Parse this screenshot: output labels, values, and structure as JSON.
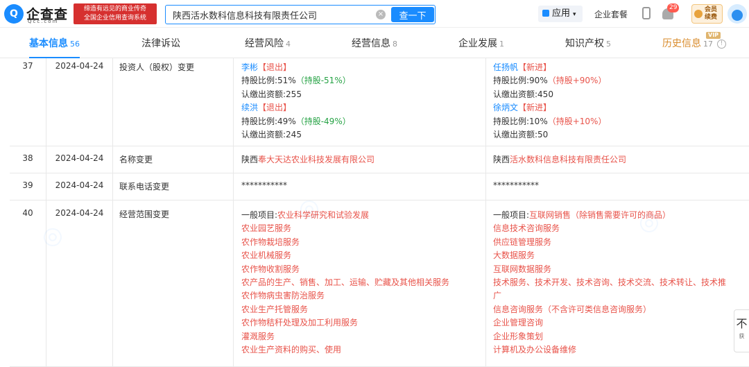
{
  "header": {
    "logo_text": "企查查",
    "logo_mark": "Q",
    "logo_url": "Qcc.com",
    "slogan_line1": "缔造有远见的商业传奇",
    "slogan_line2": "全国企业信用查询系统",
    "search_value": "陕西活水数科信息科技有限责任公司",
    "search_button": "查一下",
    "apps_label": "应用",
    "suite_label": "企业套餐",
    "notifications_count": "29",
    "member_line1": "会员",
    "member_line2": "续费"
  },
  "tabs": [
    {
      "label": "基本信息",
      "count": "56",
      "active": true
    },
    {
      "label": "法律诉讼",
      "count": ""
    },
    {
      "label": "经营风险",
      "count": "4"
    },
    {
      "label": "经营信息",
      "count": "8"
    },
    {
      "label": "企业发展",
      "count": "1"
    },
    {
      "label": "知识产权",
      "count": "5"
    },
    {
      "label": "历史信息",
      "count": "17",
      "vip": "VIP"
    }
  ],
  "rows": [
    {
      "no": "37",
      "date": "2024-04-24",
      "item": "投资人（股权）变更",
      "before": [
        {
          "name": "李彬",
          "tag": "【退出】",
          "ratio": "持股比例:51%",
          "delta": "（持股-51%）",
          "capital": "认缴出资额:255"
        },
        {
          "name": "续洪",
          "tag": "【退出】",
          "ratio": "持股比例:49%",
          "delta": "（持股-49%）",
          "capital": "认缴出资额:245"
        }
      ],
      "after": [
        {
          "name": "任扬帆",
          "tag": "【新进】",
          "ratio": "持股比例:90%",
          "delta": "（持股+90%）",
          "capital": "认缴出资额:450"
        },
        {
          "name": "徐炳文",
          "tag": "【新进】",
          "ratio": "持股比例:10%",
          "delta": "（持股+10%）",
          "capital": "认缴出资额:50"
        }
      ]
    },
    {
      "no": "38",
      "date": "2024-04-24",
      "item": "名称变更",
      "before_prefix": "陕西",
      "before_highlight": "奉大天达农业科技发展有限公司",
      "after_prefix": "陕西",
      "after_highlight": "活水数科信息科技有限责任公司"
    },
    {
      "no": "39",
      "date": "2024-04-24",
      "item": "联系电话变更",
      "before": "***********",
      "after": "***********"
    },
    {
      "no": "40",
      "date": "2024-04-24",
      "item": "经营范围变更",
      "before_prefix": "一般项目:",
      "before_lines": [
        "农业科学研究和试验发展",
        "农业园艺服务",
        "农作物栽培服务",
        "农业机械服务",
        "农作物收割服务",
        "农产品的生产、销售、加工、运输、贮藏及其他相关服务",
        "农作物病虫害防治服务",
        "农业生产托管服务",
        "农作物秸秆处理及加工利用服务",
        "灌溉服务",
        "农业生产资料的购买、使用"
      ],
      "after_prefix": "一般项目:",
      "after_lines": [
        "互联网销售（除销售需要许可的商品）",
        "信息技术咨询服务",
        "供应链管理服务",
        "大数据服务",
        "互联网数据服务",
        "技术服务、技术开发、技术咨询、技术交流、技术转让、技术推广",
        "信息咨询服务（不含许可类信息咨询服务）",
        "企业管理咨询",
        "企业形象策划",
        "计算机及办公设备维修"
      ]
    }
  ],
  "side_widget": {
    "glyph": "不",
    "sub": "获"
  }
}
